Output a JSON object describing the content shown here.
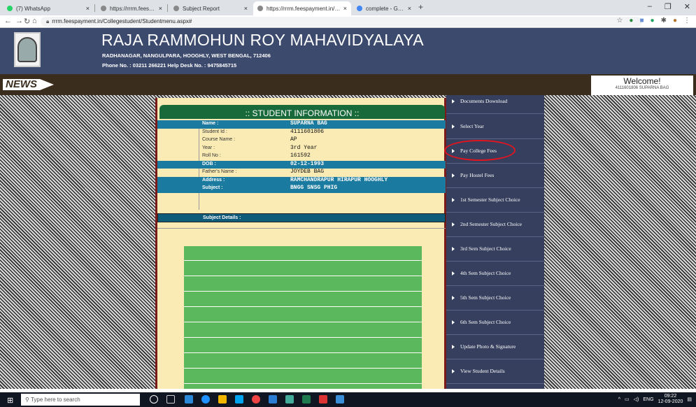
{
  "browser": {
    "tabs": [
      {
        "label": "(7) WhatsApp",
        "active": false,
        "color": "#25d366"
      },
      {
        "label": "https://rrrm.feespayment.in/Colle",
        "active": false,
        "color": "#888888"
      },
      {
        "label": "Subject Report",
        "active": false,
        "color": "#888888"
      },
      {
        "label": "https://rrrm.feespayment.in/Colle",
        "active": true,
        "color": "#888888"
      },
      {
        "label": "complete - Google Search",
        "active": false,
        "color": "#4285f4"
      }
    ],
    "url": "rrrm.feespayment.in/Collegestudent/Studentmenu.aspx#"
  },
  "header": {
    "college_name": "RAJA RAMMOHUN ROY MAHAVIDYALAYA",
    "address": "RADHANAGAR, NANGULPARA, HOOGHLY, WEST BENGAL, 712406",
    "phone": "Phone No. : 03211 266221    Help Desk No. : 9475845715"
  },
  "news": {
    "label": "NEWS"
  },
  "welcome": {
    "title": "Welcome!",
    "user": "4111601806 SUPARNA BAG"
  },
  "student": {
    "heading": ":: STUDENT INFORMATION ::",
    "rows": [
      {
        "label": "Name :",
        "value": "SUPARNA BAG",
        "style": "blue"
      },
      {
        "label": "Student Id :",
        "value": "4111601806",
        "style": "plain"
      },
      {
        "label": "Course Name :",
        "value": "AP",
        "style": "plain"
      },
      {
        "label": "Year :",
        "value": "3rd Year",
        "style": "plain"
      },
      {
        "label": "Roll No :",
        "value": "161592",
        "style": "plain"
      },
      {
        "label": "DOB :",
        "value": "02-12-1993",
        "style": "blue"
      },
      {
        "label": "Father's Name :",
        "value": "JOYDEB BAG",
        "style": "plain"
      },
      {
        "label": "Address :",
        "value": "RAMCHANDRAPUR HIRAPUR HOOGHLY",
        "style": "blue"
      },
      {
        "label": "Subject :",
        "value": "BNGG SNSG PHIG",
        "style": "blue"
      }
    ],
    "subject_details_label": "Subject Details :"
  },
  "menu": {
    "items": [
      "Documents Download",
      "Select Year",
      "Pay College Fees",
      "Pay Hostel Fees",
      "1st Semester Subject Choice",
      "2nd Semester Subject Choice",
      "3rd Sem Subject Choice",
      "4th Sem Subject Choice",
      "5th Sem Subject Choice",
      "6th Sem Subject Choice",
      "Update Photo & Signature",
      "View Student Details"
    ],
    "highlighted": "Pay College Fees"
  },
  "taskbar": {
    "search_placeholder": "Type here to search",
    "lang": "ENG",
    "time": "09:22",
    "date": "12-09-2020"
  }
}
